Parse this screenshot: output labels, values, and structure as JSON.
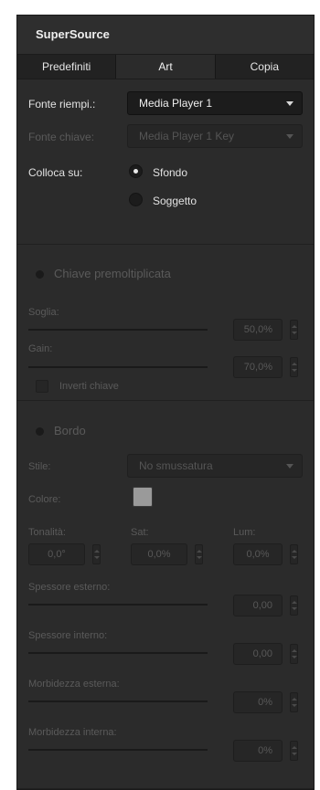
{
  "panel": {
    "title": "SuperSource"
  },
  "tabs": [
    {
      "label": "Predefiniti"
    },
    {
      "label": "Art"
    },
    {
      "label": "Copia"
    }
  ],
  "source": {
    "fill_label": "Fonte riempi.:",
    "fill_value": "Media Player 1",
    "key_label": "Fonte chiave:",
    "key_value": "Media Player 1 Key",
    "place_label": "Colloca su:",
    "option_background": "Sfondo",
    "option_foreground": "Soggetto",
    "selected": "Sfondo"
  },
  "premult": {
    "title": "Chiave premoltiplicata",
    "clip_label": "Soglia:",
    "clip_value": "50,0%",
    "clip_level": 0.5,
    "gain_label": "Gain:",
    "gain_value": "70,0%",
    "gain_level": 0.7,
    "invert_label": "Inverti chiave"
  },
  "border": {
    "title": "Bordo",
    "style_label": "Stile:",
    "style_value": "No smussatura",
    "color_label": "Colore:",
    "color_hex": "#9a9a9a",
    "hue_label": "Tonalità:",
    "hue_value": "0,0°",
    "sat_label": "Sat:",
    "sat_value": "0,0%",
    "lum_label": "Lum:",
    "lum_value": "0,0%",
    "outer_width_label": "Spessore esterno:",
    "outer_width_value": "0,00",
    "inner_width_label": "Spessore interno:",
    "inner_width_value": "0,00",
    "outer_soft_label": "Morbidezza esterna:",
    "outer_soft_value": "0%",
    "inner_soft_label": "Morbidezza interna:",
    "inner_soft_value": "0%"
  }
}
